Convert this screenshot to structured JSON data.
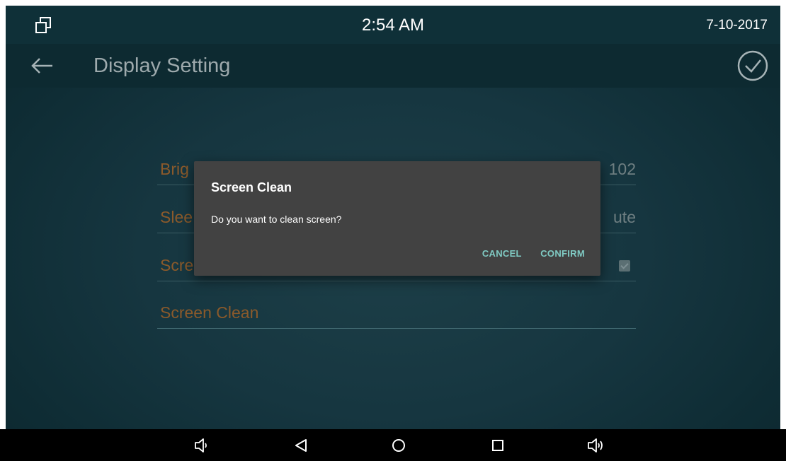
{
  "status_bar": {
    "time": "2:54 AM",
    "date": "7-10-2017",
    "left_icon": "window-restore-icon"
  },
  "app_bar": {
    "title": "Display Setting",
    "back_icon": "arrow-left-icon",
    "confirm_icon": "check-circle-icon"
  },
  "settings": {
    "brightness": {
      "label": "Brig",
      "value": "102"
    },
    "sleep": {
      "label": "Slee",
      "value": "ute"
    },
    "screensaver": {
      "label": "Scre",
      "checked": true
    },
    "clean": {
      "label": "Screen Clean"
    }
  },
  "dialog": {
    "title": "Screen Clean",
    "message": "Do you want to clean screen?",
    "cancel_label": "CANCEL",
    "confirm_label": "CONFIRM"
  },
  "nav_bar": {
    "items": [
      "volume-down-icon",
      "back-triangle-icon",
      "home-circle-icon",
      "recents-square-icon",
      "volume-up-icon"
    ]
  },
  "colors": {
    "accent": "#80cbc4",
    "setting_label": "#8b5a2b",
    "dialog_bg": "#424242"
  }
}
